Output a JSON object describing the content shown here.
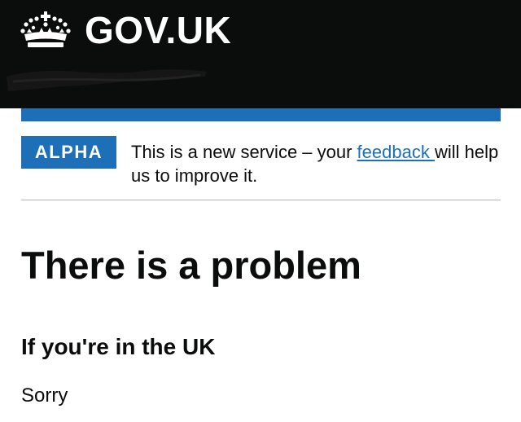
{
  "header": {
    "logo_text": "GOV.UK",
    "logo_icon": "crown-icon",
    "background_color": "#0b0c0c"
  },
  "accent_color": "#1d70b8",
  "phase_banner": {
    "tag": "ALPHA",
    "text_before": "This is a new service – your ",
    "link_text": "feedback ",
    "text_after": "will help us to improve it."
  },
  "main": {
    "title": "There is a problem",
    "subheading": "If you're in the UK",
    "body": "Sorry"
  }
}
